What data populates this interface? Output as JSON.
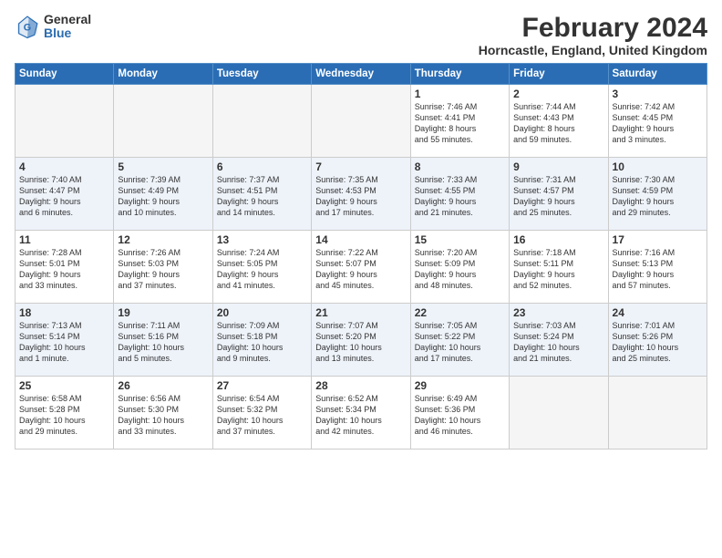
{
  "header": {
    "logo_general": "General",
    "logo_blue": "Blue",
    "title": "February 2024",
    "subtitle": "Horncastle, England, United Kingdom"
  },
  "days_of_week": [
    "Sunday",
    "Monday",
    "Tuesday",
    "Wednesday",
    "Thursday",
    "Friday",
    "Saturday"
  ],
  "weeks": [
    [
      {
        "day": "",
        "info": ""
      },
      {
        "day": "",
        "info": ""
      },
      {
        "day": "",
        "info": ""
      },
      {
        "day": "",
        "info": ""
      },
      {
        "day": "1",
        "info": "Sunrise: 7:46 AM\nSunset: 4:41 PM\nDaylight: 8 hours\nand 55 minutes."
      },
      {
        "day": "2",
        "info": "Sunrise: 7:44 AM\nSunset: 4:43 PM\nDaylight: 8 hours\nand 59 minutes."
      },
      {
        "day": "3",
        "info": "Sunrise: 7:42 AM\nSunset: 4:45 PM\nDaylight: 9 hours\nand 3 minutes."
      }
    ],
    [
      {
        "day": "4",
        "info": "Sunrise: 7:40 AM\nSunset: 4:47 PM\nDaylight: 9 hours\nand 6 minutes."
      },
      {
        "day": "5",
        "info": "Sunrise: 7:39 AM\nSunset: 4:49 PM\nDaylight: 9 hours\nand 10 minutes."
      },
      {
        "day": "6",
        "info": "Sunrise: 7:37 AM\nSunset: 4:51 PM\nDaylight: 9 hours\nand 14 minutes."
      },
      {
        "day": "7",
        "info": "Sunrise: 7:35 AM\nSunset: 4:53 PM\nDaylight: 9 hours\nand 17 minutes."
      },
      {
        "day": "8",
        "info": "Sunrise: 7:33 AM\nSunset: 4:55 PM\nDaylight: 9 hours\nand 21 minutes."
      },
      {
        "day": "9",
        "info": "Sunrise: 7:31 AM\nSunset: 4:57 PM\nDaylight: 9 hours\nand 25 minutes."
      },
      {
        "day": "10",
        "info": "Sunrise: 7:30 AM\nSunset: 4:59 PM\nDaylight: 9 hours\nand 29 minutes."
      }
    ],
    [
      {
        "day": "11",
        "info": "Sunrise: 7:28 AM\nSunset: 5:01 PM\nDaylight: 9 hours\nand 33 minutes."
      },
      {
        "day": "12",
        "info": "Sunrise: 7:26 AM\nSunset: 5:03 PM\nDaylight: 9 hours\nand 37 minutes."
      },
      {
        "day": "13",
        "info": "Sunrise: 7:24 AM\nSunset: 5:05 PM\nDaylight: 9 hours\nand 41 minutes."
      },
      {
        "day": "14",
        "info": "Sunrise: 7:22 AM\nSunset: 5:07 PM\nDaylight: 9 hours\nand 45 minutes."
      },
      {
        "day": "15",
        "info": "Sunrise: 7:20 AM\nSunset: 5:09 PM\nDaylight: 9 hours\nand 48 minutes."
      },
      {
        "day": "16",
        "info": "Sunrise: 7:18 AM\nSunset: 5:11 PM\nDaylight: 9 hours\nand 52 minutes."
      },
      {
        "day": "17",
        "info": "Sunrise: 7:16 AM\nSunset: 5:13 PM\nDaylight: 9 hours\nand 57 minutes."
      }
    ],
    [
      {
        "day": "18",
        "info": "Sunrise: 7:13 AM\nSunset: 5:14 PM\nDaylight: 10 hours\nand 1 minute."
      },
      {
        "day": "19",
        "info": "Sunrise: 7:11 AM\nSunset: 5:16 PM\nDaylight: 10 hours\nand 5 minutes."
      },
      {
        "day": "20",
        "info": "Sunrise: 7:09 AM\nSunset: 5:18 PM\nDaylight: 10 hours\nand 9 minutes."
      },
      {
        "day": "21",
        "info": "Sunrise: 7:07 AM\nSunset: 5:20 PM\nDaylight: 10 hours\nand 13 minutes."
      },
      {
        "day": "22",
        "info": "Sunrise: 7:05 AM\nSunset: 5:22 PM\nDaylight: 10 hours\nand 17 minutes."
      },
      {
        "day": "23",
        "info": "Sunrise: 7:03 AM\nSunset: 5:24 PM\nDaylight: 10 hours\nand 21 minutes."
      },
      {
        "day": "24",
        "info": "Sunrise: 7:01 AM\nSunset: 5:26 PM\nDaylight: 10 hours\nand 25 minutes."
      }
    ],
    [
      {
        "day": "25",
        "info": "Sunrise: 6:58 AM\nSunset: 5:28 PM\nDaylight: 10 hours\nand 29 minutes."
      },
      {
        "day": "26",
        "info": "Sunrise: 6:56 AM\nSunset: 5:30 PM\nDaylight: 10 hours\nand 33 minutes."
      },
      {
        "day": "27",
        "info": "Sunrise: 6:54 AM\nSunset: 5:32 PM\nDaylight: 10 hours\nand 37 minutes."
      },
      {
        "day": "28",
        "info": "Sunrise: 6:52 AM\nSunset: 5:34 PM\nDaylight: 10 hours\nand 42 minutes."
      },
      {
        "day": "29",
        "info": "Sunrise: 6:49 AM\nSunset: 5:36 PM\nDaylight: 10 hours\nand 46 minutes."
      },
      {
        "day": "",
        "info": ""
      },
      {
        "day": "",
        "info": ""
      }
    ]
  ]
}
